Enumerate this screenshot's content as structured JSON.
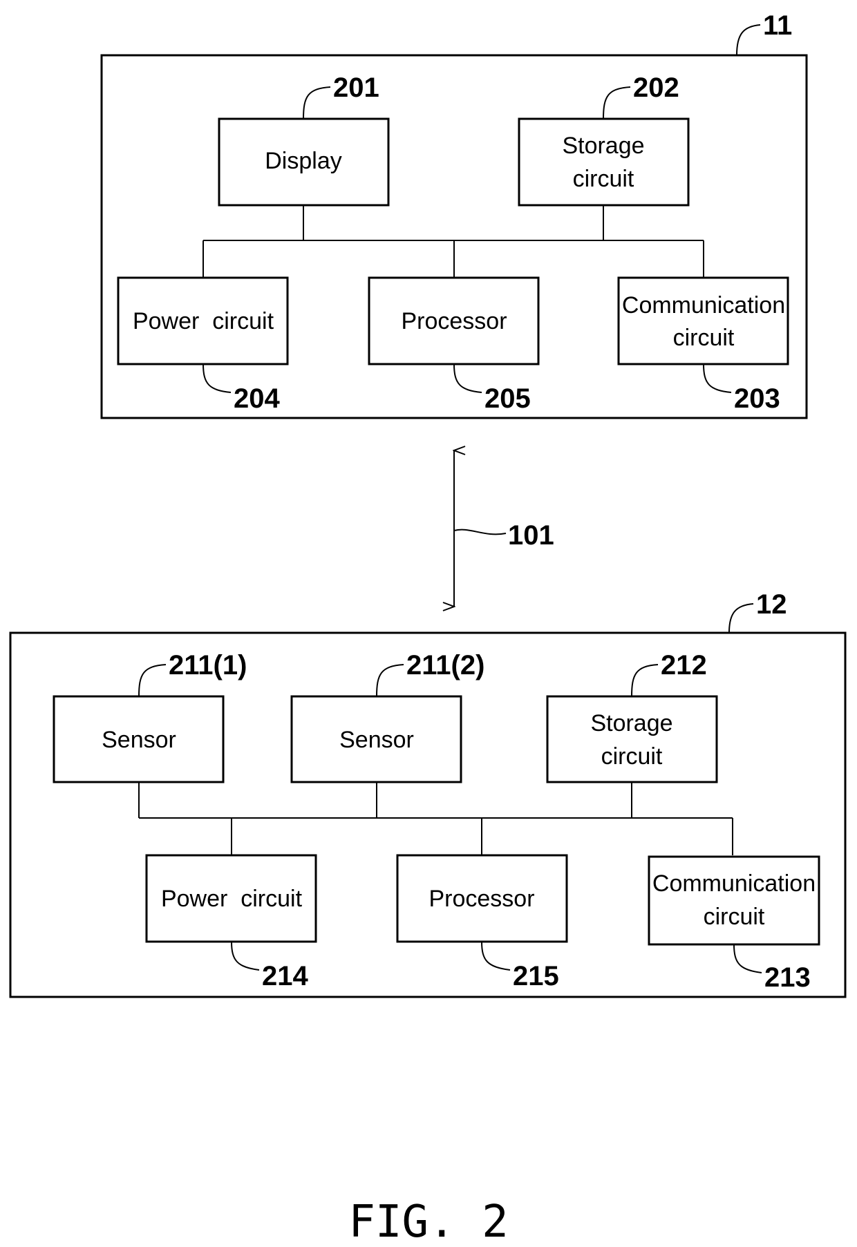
{
  "figure_label": "FIG. 2",
  "device_11": {
    "ref": "11",
    "components": {
      "display": {
        "label": [
          "Display"
        ],
        "ref": "201"
      },
      "storage": {
        "label": [
          "Storage",
          "circuit"
        ],
        "ref": "202"
      },
      "power": {
        "label": [
          "Power  circuit"
        ],
        "ref": "204"
      },
      "processor": {
        "label": [
          "Processor"
        ],
        "ref": "205"
      },
      "communication": {
        "label": [
          "Communication",
          "circuit"
        ],
        "ref": "203"
      }
    }
  },
  "link": {
    "ref": "101"
  },
  "device_12": {
    "ref": "12",
    "components": {
      "sensor1": {
        "label": [
          "Sensor"
        ],
        "ref": "211(1)"
      },
      "sensor2": {
        "label": [
          "Sensor"
        ],
        "ref": "211(2)"
      },
      "storage": {
        "label": [
          "Storage",
          "circuit"
        ],
        "ref": "212"
      },
      "power": {
        "label": [
          "Power  circuit"
        ],
        "ref": "214"
      },
      "processor": {
        "label": [
          "Processor"
        ],
        "ref": "215"
      },
      "communication": {
        "label": [
          "Communication",
          "circuit"
        ],
        "ref": "213"
      }
    }
  }
}
